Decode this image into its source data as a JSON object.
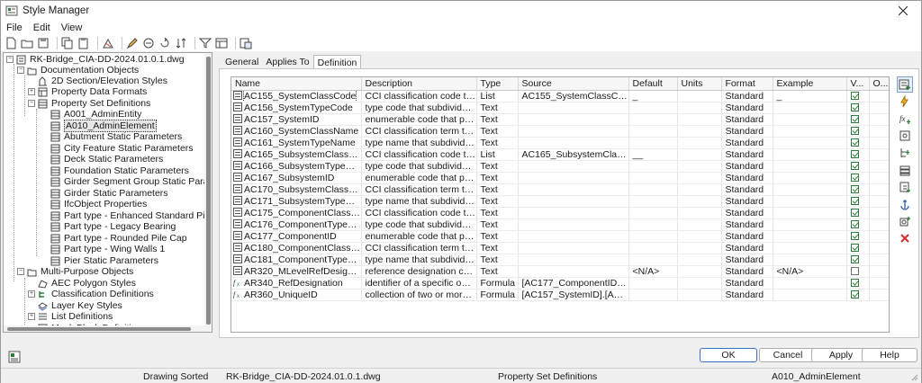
{
  "window": {
    "title": "Style Manager"
  },
  "menu": [
    "File",
    "Edit",
    "View"
  ],
  "toolbar_icons": [
    "new-drawing-icon",
    "open-folder-icon",
    "save-icon",
    "copy-icon",
    "paste-icon",
    "purge-icon",
    "edit-style-icon",
    "toggle-view-icon",
    "refresh-icon",
    "sort-icon",
    "filter-icon",
    "view-options-icon",
    "help-icon"
  ],
  "tree": {
    "root": "RK-Bridge_CIA-DD-2024.01.0.1.dwg",
    "documentation": "Documentation Objects",
    "section_elevation": "2D Section/Elevation Styles",
    "property_data_formats": "Property Data Formats",
    "property_set_definitions": "Property Set Definitions",
    "psd_items": [
      "A001_AdminEntity",
      "A010_AdminElement",
      "Abutment Static Parameters",
      "City Feature Static Parameters",
      "Deck Static Parameters",
      "Foundation Static Parameters",
      "Girder Segment Group Static Parameter",
      "Girder Static Parameters",
      "IfcObject Properties",
      "Part type - Enhanced Standard Pier",
      "Part type - Legacy Bearing",
      "Part type - Rounded Pile Cap",
      "Part type - Wing Walls 1",
      "Pier Static Parameters"
    ],
    "multi_purpose": "Multi-Purpose Objects",
    "mp_items": [
      "AEC Polygon Styles",
      "Classification Definitions",
      "Layer Key Styles",
      "List Definitions",
      "Mask Block Definitions"
    ]
  },
  "tabs": [
    "General",
    "Applies To",
    "Definition"
  ],
  "active_tab": "Definition",
  "grid": {
    "columns": [
      "Name",
      "Description",
      "Type",
      "Source",
      "Default",
      "Units",
      "Format",
      "Example",
      "V...",
      "O..."
    ],
    "rows": [
      {
        "name": "AC155_SystemClassCode",
        "desc": "CCI classification code that id...",
        "type": "List",
        "source": "AC155_SystemClassCode",
        "default": "_",
        "units": "",
        "format": "Standard",
        "example": "_",
        "visible": true
      },
      {
        "name": "AC156_SystemTypeCode",
        "desc": "type code that subdivides th...",
        "type": "Text",
        "source": "",
        "default": "",
        "units": "",
        "format": "Standard",
        "example": "",
        "visible": true
      },
      {
        "name": "AC157_SystemID",
        "desc": "enumerable code that points ...",
        "type": "Text",
        "source": "",
        "default": "",
        "units": "",
        "format": "Standard",
        "example": "",
        "visible": true
      },
      {
        "name": "AC160_SystemClassName",
        "desc": "CCI classification term that id...",
        "type": "Text",
        "source": "",
        "default": "",
        "units": "",
        "format": "Standard",
        "example": "",
        "visible": true
      },
      {
        "name": "AC161_SystemTypeName",
        "desc": "type name that subdivides th...",
        "type": "Text",
        "source": "",
        "default": "",
        "units": "",
        "format": "Standard",
        "example": "",
        "visible": true
      },
      {
        "name": "AC165_SubsystemClassCode",
        "desc": "CCI classification code that id...",
        "type": "List",
        "source": "AC165_SubsystemClassCode",
        "default": "__",
        "units": "",
        "format": "Standard",
        "example": "",
        "visible": true
      },
      {
        "name": "AC166_SubsystemTypeCode",
        "desc": "type code that subdivides th...",
        "type": "Text",
        "source": "",
        "default": "",
        "units": "",
        "format": "Standard",
        "example": "",
        "visible": true
      },
      {
        "name": "AC167_SubsystemID",
        "desc": "enumerable code that points ...",
        "type": "Text",
        "source": "",
        "default": "",
        "units": "",
        "format": "Standard",
        "example": "",
        "visible": true
      },
      {
        "name": "AC170_SubsystemClassName",
        "desc": "CCI classification term that id...",
        "type": "Text",
        "source": "",
        "default": "",
        "units": "",
        "format": "Standard",
        "example": "",
        "visible": true
      },
      {
        "name": "AC171_SubsystemTypeName",
        "desc": "type name that subdivides th...",
        "type": "Text",
        "source": "",
        "default": "",
        "units": "",
        "format": "Standard",
        "example": "",
        "visible": true
      },
      {
        "name": "AC175_ComponentClassCode",
        "desc": "CCI classification code that id...",
        "type": "Text",
        "source": "",
        "default": "",
        "units": "",
        "format": "Standard",
        "example": "",
        "visible": true
      },
      {
        "name": "AC176_ComponentTypeCode",
        "desc": "type code that subdivides th...",
        "type": "Text",
        "source": "",
        "default": "",
        "units": "",
        "format": "Standard",
        "example": "",
        "visible": true
      },
      {
        "name": "AC177_ComponentID",
        "desc": "enumerable code that points ...",
        "type": "Text",
        "source": "",
        "default": "",
        "units": "",
        "format": "Standard",
        "example": "",
        "visible": true
      },
      {
        "name": "AC180_ComponentClassName",
        "desc": "CCI classification term that id...",
        "type": "Text",
        "source": "",
        "default": "",
        "units": "",
        "format": "Standard",
        "example": "",
        "visible": true
      },
      {
        "name": "AC181_ComponentTypeName",
        "desc": "type name that subdivides th...",
        "type": "Text",
        "source": "",
        "default": "",
        "units": "",
        "format": "Standard",
        "example": "",
        "visible": true
      },
      {
        "name": "AR320_MLevelRefDesignation",
        "desc": "reference designation consist...",
        "type": "Text",
        "source": "",
        "default": "<N/A>",
        "units": "",
        "format": "Standard",
        "example": "<N/A>",
        "visible": false
      },
      {
        "name": "AR340_RefDesignation",
        "desc": "identifier of a specific object ...",
        "type": "Formula",
        "source": "[AC177_ComponentID]|%|AC...",
        "default": "",
        "units": "",
        "format": "Standard",
        "example": "",
        "visible": true
      },
      {
        "name": "AR360_UniqueID",
        "desc": "collection of two or more ref...",
        "type": "Formula",
        "source": "[AC157_SystemID].[AC167_S...",
        "default": "",
        "units": "",
        "format": "Standard",
        "example": "",
        "visible": true
      }
    ]
  },
  "side_tools": [
    "add-property-icon",
    "add-auto-property-icon",
    "add-formula-icon",
    "add-location-icon",
    "add-graphic-icon",
    "add-classification-icon",
    "add-material-icon",
    "add-anchor-icon",
    "add-project-icon",
    "remove-icon"
  ],
  "buttons": {
    "ok": "OK",
    "cancel": "Cancel",
    "apply": "Apply",
    "help": "Help"
  },
  "status": {
    "sort": "Drawing Sorted",
    "file": "RK-Bridge_CIA-DD-2024.01.0.1.dwg",
    "category": "Property Set Definitions",
    "selection": "A010_AdminElement"
  },
  "colors": {
    "check_green": "#2f7d3a",
    "remove_red": "#d32f2f",
    "ok_border": "#3a6fc4"
  }
}
